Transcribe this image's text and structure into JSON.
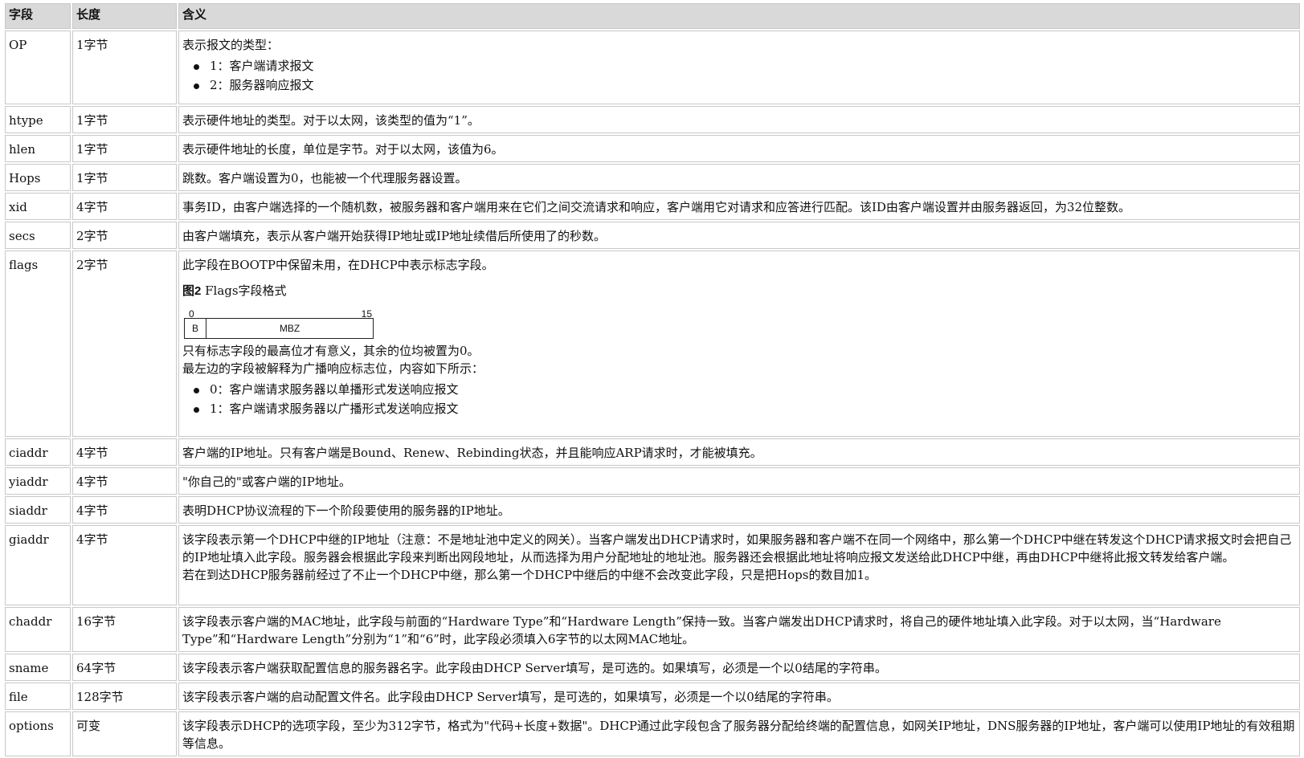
{
  "headers": [
    "字段",
    "长度",
    "含义"
  ],
  "rows": [
    {
      "field": "OP",
      "length": "1字节",
      "lines": [
        "表示报文的类型："
      ],
      "bullets": [
        "1：客户端请求报文",
        "2：服务器响应报文"
      ]
    },
    {
      "field": "htype",
      "length": "1字节",
      "lines": [
        "表示硬件地址的类型。对于以太网，该类型的值为“1”。"
      ]
    },
    {
      "field": "hlen",
      "length": "1字节",
      "lines": [
        "表示硬件地址的长度，单位是字节。对于以太网，该值为6。"
      ]
    },
    {
      "field": "Hops",
      "length": "1字节",
      "lines": [
        "跳数。客户端设置为0，也能被一个代理服务器设置。"
      ]
    },
    {
      "field": "xid",
      "length": "4字节",
      "lines": [
        "事务ID，由客户端选择的一个随机数，被服务器和客户端用来在它们之间交流请求和响应，客户端用它对请求和应答进行匹配。该ID由客户端设置并由服务器返回，为32位整数。"
      ]
    },
    {
      "field": "secs",
      "length": "2字节",
      "lines": [
        "由客户端填充，表示从客户端开始获得IP地址或IP地址续借后所使用了的秒数。"
      ]
    },
    {
      "field": "flags",
      "length": "2字节",
      "lines": [
        "此字段在BOOTP中保留未用，在DHCP中表示标志字段。"
      ],
      "figure": {
        "title_bold": "图2",
        "title_rest": " Flags字段格式",
        "bit_start": "0",
        "bit_end": "15",
        "bit_b": "B",
        "bit_mbz": "MBZ"
      },
      "after_lines": [
        "只有标志字段的最高位才有意义，其余的位均被置为0。",
        "最左边的字段被解释为广播响应标志位，内容如下所示："
      ],
      "bullets": [
        "0：客户端请求服务器以单播形式发送响应报文",
        "1：客户端请求服务器以广播形式发送响应报文"
      ]
    },
    {
      "field": "ciaddr",
      "length": "4字节",
      "lines": [
        "客户端的IP地址。只有客户端是Bound、Renew、Rebinding状态，并且能响应ARP请求时，才能被填充。"
      ]
    },
    {
      "field": "yiaddr",
      "length": "4字节",
      "lines": [
        "\"你自己的\"或客户端的IP地址。"
      ]
    },
    {
      "field": "siaddr",
      "length": "4字节",
      "lines": [
        "表明DHCP协议流程的下一个阶段要使用的服务器的IP地址。"
      ]
    },
    {
      "field": "giaddr",
      "length": "4字节",
      "lines": [
        "该字段表示第一个DHCP中继的IP地址（注意：不是地址池中定义的网关）。当客户端发出DHCP请求时，如果服务器和客户端不在同一个网络中，那么第一个DHCP中继在转发这个DHCP请求报文时会把自己的IP地址填入此字段。服务器会根据此字段来判断出网段地址，从而选择为用户分配地址的地址池。服务器还会根据此地址将响应报文发送给此DHCP中继，再由DHCP中继将此报文转发给客户端。",
        "若在到达DHCP服务器前经过了不止一个DHCP中继，那么第一个DHCP中继后的中继不会改变此字段，只是把Hops的数目加1。"
      ]
    },
    {
      "field": "chaddr",
      "length": "16字节",
      "lines": [
        "该字段表示客户端的MAC地址，此字段与前面的“Hardware Type”和“Hardware Length”保持一致。当客户端发出DHCP请求时，将自己的硬件地址填入此字段。对于以太网，当“Hardware Type”和“Hardware Length”分别为“1”和“6”时，此字段必须填入6字节的以太网MAC地址。"
      ]
    },
    {
      "field": "sname",
      "length": "64字节",
      "lines": [
        "该字段表示客户端获取配置信息的服务器名字。此字段由DHCP Server填写，是可选的。如果填写，必须是一个以0结尾的字符串。"
      ]
    },
    {
      "field": "file",
      "length": "128字节",
      "lines": [
        "该字段表示客户端的启动配置文件名。此字段由DHCP Server填写，是可选的，如果填写，必须是一个以0结尾的字符串。"
      ]
    },
    {
      "field": "options",
      "length": "可变",
      "lines": [
        "该字段表示DHCP的选项字段，至少为312字节，格式为\"代码+长度+数据\"。DHCP通过此字段包含了服务器分配给终端的配置信息，如网关IP地址，DNS服务器的IP地址，客户端可以使用IP地址的有效租期等信息。"
      ]
    }
  ]
}
